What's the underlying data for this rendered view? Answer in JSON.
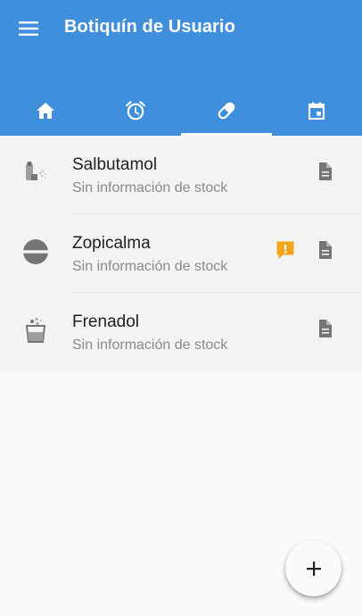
{
  "appbar": {
    "title": "Botiquín de Usuario",
    "menu_icon": "hamburger-menu-icon",
    "color": "#3f8fdd"
  },
  "tabs": [
    {
      "icon": "home-icon",
      "active": false
    },
    {
      "icon": "alarm-clock-icon",
      "active": false
    },
    {
      "icon": "pill-icon",
      "active": true
    },
    {
      "icon": "calendar-event-icon",
      "active": false
    }
  ],
  "medications": [
    {
      "name": "Salbutamol",
      "stock": "Sin información de stock",
      "icon": "inhaler-icon",
      "alert": false
    },
    {
      "name": "Zopicalma",
      "stock": "Sin información de stock",
      "icon": "tablet-icon",
      "alert": true
    },
    {
      "name": "Frenadol",
      "stock": "Sin información de stock",
      "icon": "effervescent-glass-icon",
      "alert": false
    }
  ],
  "fab": {
    "icon": "plus-icon"
  },
  "colors": {
    "alert": "#f2a51a",
    "icon_grey": "#757575"
  }
}
